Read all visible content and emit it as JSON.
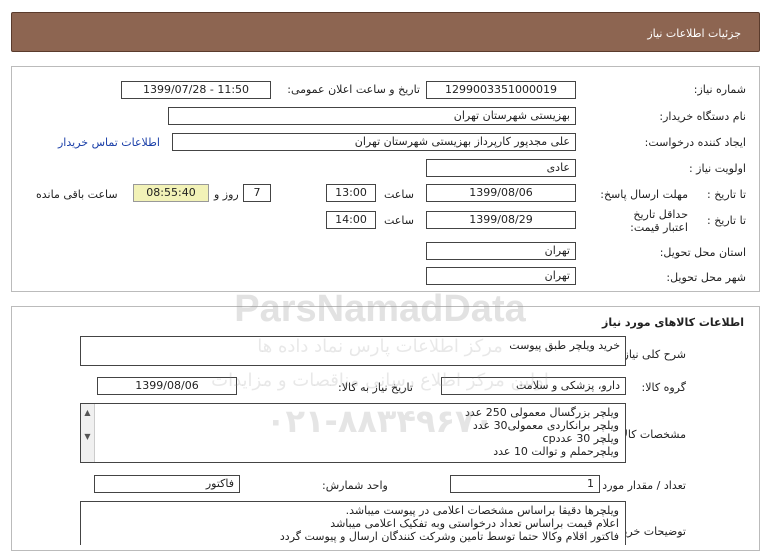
{
  "header": {
    "title": "جزئیات اطلاعات نیاز"
  },
  "form": {
    "need_number_label": "شماره نیاز:",
    "need_number_value": "1299003351000019",
    "announce_label": "تاریخ و ساعت اعلان عمومی:",
    "announce_value": "1399/07/28 - 11:50",
    "buyer_org_label": "نام دستگاه خریدار:",
    "buyer_org_value": "بهزیستی شهرستان تهران",
    "creator_label": "ایجاد کننده درخواست:",
    "creator_value": "علی  مجدپور کارپرداز  بهزیستی شهرستان تهران",
    "contact_link": "اطلاعات تماس خریدار",
    "priority_label": "اولویت نیاز :",
    "priority_value": "عادی",
    "reply_deadline_label": "مهلت ارسال پاسخ:",
    "to_date_label": "تا تاریخ :",
    "reply_date": "1399/08/06",
    "time_label": "ساعت",
    "reply_time": "13:00",
    "days_value": "7",
    "days_label": "روز و",
    "remaining_time": "08:55:40",
    "remaining_label": "ساعت باقی مانده",
    "validity_label": "حداقل تاریخ اعتبار قیمت:",
    "validity_date": "1399/08/29",
    "validity_time": "14:00",
    "province_label": "استان محل تحویل:",
    "province_value": "تهران",
    "city_label": "شهر محل تحویل:",
    "city_value": "تهران"
  },
  "goods": {
    "section_title": "اطلاعات کالاهای مورد نیاز",
    "general_desc_label": "شرح کلی نیاز:",
    "general_desc_value": "خرید ویلچر طبق پیوست",
    "group_label": "گروه کالا:",
    "group_value": "دارو، پزشکی و سلامت",
    "need_date_label": "تاریخ نیاز به کالا:",
    "need_date_value": "1399/08/06",
    "specs_label": "مشخصات کالای مورد نیاز:",
    "specs_lines": [
      "ویلچر بزرگسال معمولی 250 عدد",
      "ویلچر برانکاردی معمولی30 عدد",
      "ویلچر  30 عددcp",
      "ویلچرحملم و توالت 10 عدد"
    ],
    "qty_label": "تعداد / مقدار مورد نیاز:",
    "qty_value": "1",
    "unit_label": "واحد شمارش:",
    "unit_value": "فاکتور",
    "buyer_notes_label": "توضیحات خریدار:",
    "buyer_notes_lines": [
      "ویلچرها دقیقا براساس مشخصات اعلامی در پیوست میباشد.",
      "اعلام قیمت براساس تعداد درخواستی وبه تفکیک اعلامی میباشد",
      "فاکتور اقلام وکالا حتما توسط تامین وشرکت کنندگان ارسال و پیوست گردد"
    ]
  },
  "watermark": {
    "brand": "ParsNamadData",
    "tagline": "مرکز اطلاعات پارس نماد داده ها",
    "line2": "اولین مرکز اطلاع رسانی مناقصات و مزایدات",
    "phone": "۰۲۱-۸۸۳۴۹۶۷۰"
  }
}
